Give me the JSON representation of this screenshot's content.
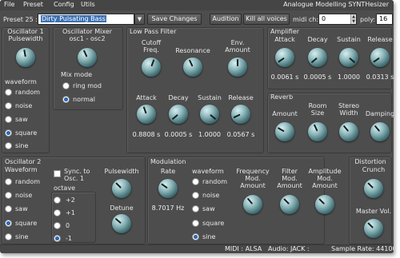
{
  "menu": {
    "file": "File",
    "preset": "Preset",
    "config": "Config",
    "utils": "Utils"
  },
  "app_title": "Analogue Modelling SYNTHesizer",
  "toolbar": {
    "preset_label": "Preset 25 :",
    "preset_name": "Dirty Pulsating Bass",
    "save_changes": "Save Changes",
    "audition": "Audition",
    "kill_all_voices": "Kill all voices",
    "midi_ch_label": "midi ch:",
    "midi_ch_value": "0",
    "poly_label": "poly:",
    "poly_value": "16"
  },
  "osc1": {
    "title": "Oscillator 1",
    "pulsewidth": "Pulsewidth",
    "waveform_label": "waveform",
    "waveforms": [
      "random",
      "noise",
      "saw",
      "square",
      "sine"
    ],
    "selected": "square"
  },
  "osc_mixer": {
    "title": "Oscillator Mixer",
    "balance": "osc1  -  osc2",
    "mix_mode_label": "Mix mode",
    "modes": [
      "ring mod",
      "normal"
    ],
    "selected": "normal"
  },
  "lpf": {
    "title": "Low Pass Filter",
    "cutoff": "Cutoff\nFreq.",
    "resonance": "Resonance",
    "env_amount": "Env.\nAmount",
    "attack": "Attack",
    "decay": "Decay",
    "sustain": "Sustain",
    "release": "Release",
    "attack_value": "0.8808 s",
    "decay_value": "0.0005 s",
    "sustain_value": "1.0000",
    "release_value": "0.0567 s"
  },
  "amplifier": {
    "title": "Amplifier",
    "attack": "Attack",
    "decay": "Decay",
    "sustain": "Sustain",
    "release": "Release",
    "attack_value": "0.0061 s",
    "decay_value": "0.0005 s",
    "sustain_value": "1.0000",
    "release_value": "0.0313 s"
  },
  "reverb": {
    "title": "Reverb",
    "amount": "Amount",
    "room_size": "Room\nSize",
    "stereo_width": "Stereo\nWidth",
    "damping": "Damping"
  },
  "osc2": {
    "title": "Oscillator 2",
    "waveform_label": "Waveform",
    "waveforms": [
      "random",
      "noise",
      "saw",
      "square",
      "sine"
    ],
    "selected": "square",
    "sync_label": "Sync. to\nOsc. 1",
    "sync_checked": false,
    "octave_label": "octave",
    "octaves": [
      "+2",
      "+1",
      "0",
      "-1"
    ],
    "octave_selected": "-1",
    "pulsewidth": "Pulsewidth",
    "detune": "Detune"
  },
  "modulation": {
    "title": "Modulation",
    "rate": "Rate",
    "rate_value": "8.7017 Hz",
    "waveform_label": "waveform",
    "waveforms": [
      "random",
      "noise",
      "saw",
      "square",
      "sine"
    ],
    "selected": "sine",
    "freq_mod": "Frequency\nMod.\nAmount",
    "filter_mod": "Filter\nMod.\nAmount",
    "amp_mod": "Amplitude\nMod.\nAmount"
  },
  "distortion": {
    "title": "Distortion",
    "crunch": "Crunch",
    "master_vol": "Master Vol."
  },
  "status": {
    "midi": "MIDI : ALSA",
    "audio": "Audio: JACK :",
    "sample_rate": "Sample Rate: 44100"
  },
  "colors": {
    "background": "#4d4d4d",
    "knob": "#5f9ea3",
    "radio_selected": "#1d5aa8"
  }
}
